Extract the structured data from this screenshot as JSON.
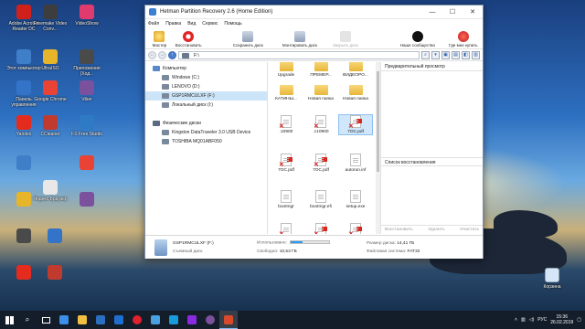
{
  "window": {
    "title": "Hetman Partition Recovery 2.6 (Home Edition)",
    "min": "—",
    "max": "☐",
    "close": "✕"
  },
  "menu": [
    "Файл",
    "Правка",
    "Вид",
    "Сервис",
    "Помощь"
  ],
  "toolbar": {
    "master": "Мастер",
    "restore": "Восстановить",
    "save_disk": "Сохранить диск",
    "mount_disk": "Монтировать диск",
    "close_disk": "Закрыть диск",
    "community": "Наше сообщество",
    "where_buy": "Где мне купить"
  },
  "address": {
    "path": "F:\\",
    "back": "←",
    "forward": "→",
    "up": "↑"
  },
  "tree": [
    {
      "label": "Компьютер",
      "color": "#5a88c8"
    },
    {
      "label": "Windows (C:)",
      "color": "#7a8a9c"
    },
    {
      "label": "LENOVO (D:)",
      "color": "#7a8a9c"
    },
    {
      "label": "GSP1RMCULXF (F:)",
      "color": "#7a8a9c",
      "selected": true
    },
    {
      "label": "Локальный диск (I:)",
      "color": "#7a8a9c"
    },
    {
      "label": "",
      "color": "transparent"
    },
    {
      "label": "Физические диски",
      "color": "#5a6a80"
    },
    {
      "label": "Kingston DataTraveler 3.0 USB Device",
      "color": "#7a8a9c"
    },
    {
      "label": "TOSHIBA MQ01ABF050",
      "color": "#7a8a9c"
    }
  ],
  "files": [
    {
      "name": "Upgrade",
      "kind": "folder-top"
    },
    {
      "name": "ПРЕМЕР...",
      "kind": "folder-top"
    },
    {
      "name": "ВИДЕОРО...",
      "kind": "folder-top"
    },
    {
      "name": "КАТИНЫ...",
      "kind": "folder"
    },
    {
      "name": "Новая папка",
      "kind": "folder"
    },
    {
      "name": "Новая папка",
      "kind": "folder"
    },
    {
      "name": ".10900",
      "kind": "deleted"
    },
    {
      "name": ".c10900",
      "kind": "deleted"
    },
    {
      "name": "7OC.pdf",
      "kind": "deleted-pdf",
      "selected": true
    },
    {
      "name": "7OC.pdf",
      "kind": "deleted-pdf"
    },
    {
      "name": "7OC.pdf",
      "kind": "deleted-pdf"
    },
    {
      "name": "autorun.inf",
      "kind": "doc"
    },
    {
      "name": "bootmgr",
      "kind": "doc"
    },
    {
      "name": "bootmgr.efi",
      "kind": "doc"
    },
    {
      "name": "setup.exe",
      "kind": "doc"
    },
    {
      "name": "ПЛАЗА.mp4",
      "kind": "deleted"
    },
    {
      "name": "Самсунг.pdf",
      "kind": "deleted-pdf"
    },
    {
      "name": "Самсунг.pdf",
      "kind": "deleted-pdf"
    }
  ],
  "preview": {
    "header": "Предварительный просмотр",
    "list_header": "Список восстановления",
    "restore": "Восстановить",
    "delete": "Удалить",
    "clear": "Очистить"
  },
  "status": {
    "disk_name": "GSP1RMCULXF (F:)",
    "disk_type": "Съемный диск",
    "used_label": "Использовано:",
    "used_fraction": 0.3,
    "free_label": "Свободно:",
    "free_value": "10,53 ГБ",
    "size_label": "Размер диска:",
    "size_value": "14,41 ГБ",
    "fs_label": "Файловая система:",
    "fs_value": "FAT32"
  },
  "desktop": [
    {
      "label": "Adobe Acrobat Reader DC",
      "color": "#d0201c"
    },
    {
      "label": "Freemake Video Conv...",
      "color": "#3d3d3d"
    },
    {
      "label": "VideoShow",
      "color": "#e03a6e"
    },
    {
      "label": "Этот компьютер",
      "color": "#3f7fc9"
    },
    {
      "label": "UltraISO",
      "color": "#e6b52a"
    },
    {
      "label": "Приложения (Ход...",
      "color": "#4a4a4a"
    },
    {
      "label": "Панель управления",
      "color": "#3474c8"
    },
    {
      "label": "Google Chrome",
      "color": "#e94335"
    },
    {
      "label": "Viber",
      "color": "#7b519d"
    },
    {
      "label": "Yandex",
      "color": "#e32c1e"
    },
    {
      "label": "CCleaner",
      "color": "#c03b2e"
    },
    {
      "label": "FS Free Studio",
      "color": "#2e7bc4"
    },
    {
      "label": "Яндекс Браузер",
      "color": "#e8e8e8"
    },
    {
      "label": "Корзина",
      "color": "#cfe1f3"
    }
  ],
  "taskbar": {
    "search": "⌕",
    "lang": "РУС",
    "time": "15:36",
    "date": "26.02.2019"
  }
}
